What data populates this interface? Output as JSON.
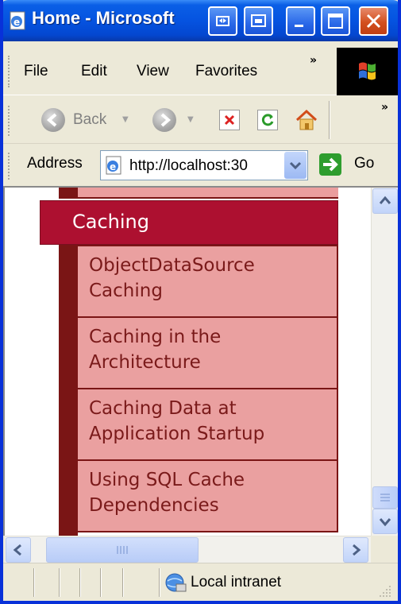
{
  "window": {
    "title": "Home - Microsoft"
  },
  "menubar": {
    "items": [
      "File",
      "Edit",
      "View",
      "Favorites"
    ],
    "overflow": "»"
  },
  "toolbar": {
    "back_label": "Back",
    "overflow": "»"
  },
  "address": {
    "label": "Address",
    "url": "http://localhost:30",
    "go_label": "Go"
  },
  "page": {
    "section_title": "Caching",
    "items": [
      {
        "line1": "ObjectDataSource",
        "line2": "Caching"
      },
      {
        "line1": "Caching in the",
        "line2": "Architecture"
      },
      {
        "line1": "Caching Data at",
        "line2": "Application Startup"
      },
      {
        "line1": "Using SQL Cache",
        "line2": "Dependencies"
      }
    ]
  },
  "statusbar": {
    "zone": "Local intranet"
  },
  "colors": {
    "section_header": "#ad1030",
    "menu_item_bg": "#eaa0a0",
    "menu_border": "#7a1515",
    "xp_blue": "#0553e0"
  },
  "icons": [
    "ie-page-icon",
    "restore-icon",
    "switch-icon",
    "minimize-icon",
    "maximize-icon",
    "close-icon",
    "windows-logo-icon",
    "back-arrow-icon",
    "forward-arrow-icon",
    "stop-icon",
    "refresh-icon",
    "home-icon",
    "go-arrow-icon",
    "local-intranet-icon"
  ]
}
